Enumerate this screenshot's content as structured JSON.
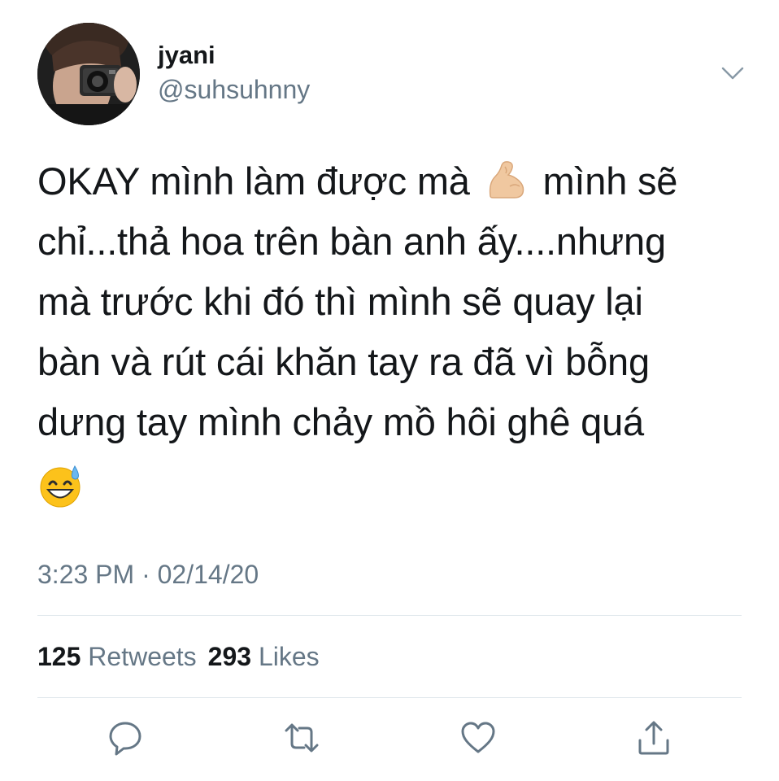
{
  "user": {
    "display_name": "jyani",
    "handle": "@suhsuhnny"
  },
  "tweet": {
    "lines": [
      {
        "before": "OKAY mình làm được mà ",
        "emoji": "flexed-biceps-emoji",
        "after": " mình sẽ"
      },
      {
        "text": "chỉ...thả hoa trên bàn anh ấy....nhưng"
      },
      {
        "text": "mà trước khi đó thì mình sẽ quay lại"
      },
      {
        "text": "bàn và rút cái khăn tay ra đã vì bỗng"
      },
      {
        "text": "dưng tay mình chảy mồ hôi ghê quá"
      }
    ],
    "trailing_emoji": "grinning-face-with-sweat-emoji",
    "timestamp": "3:23 PM · 02/14/20"
  },
  "stats": {
    "retweets_count": "125",
    "retweets_label": "Retweets",
    "likes_count": "293",
    "likes_label": "Likes"
  },
  "actions": [
    {
      "icon": "reply-icon"
    },
    {
      "icon": "retweet-icon"
    },
    {
      "icon": "like-icon"
    },
    {
      "icon": "share-icon"
    }
  ],
  "colors": {
    "primary_text": "#14171a",
    "secondary_text": "#657786",
    "divider": "#e1e8ed"
  }
}
